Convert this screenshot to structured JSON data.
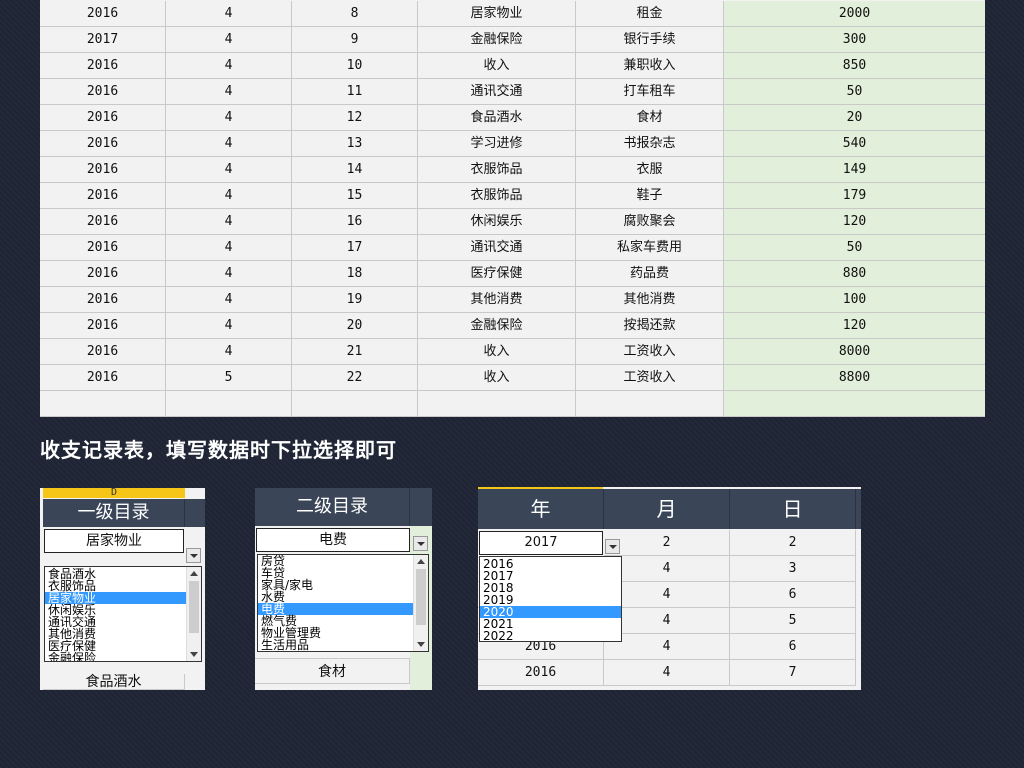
{
  "main_table": {
    "rows": [
      [
        "2016",
        "4",
        "8",
        "居家物业",
        "租金",
        "2000"
      ],
      [
        "2017",
        "4",
        "9",
        "金融保险",
        "银行手续",
        "300"
      ],
      [
        "2016",
        "4",
        "10",
        "收入",
        "兼职收入",
        "850"
      ],
      [
        "2016",
        "4",
        "11",
        "通讯交通",
        "打车租车",
        "50"
      ],
      [
        "2016",
        "4",
        "12",
        "食品酒水",
        "食材",
        "20"
      ],
      [
        "2016",
        "4",
        "13",
        "学习进修",
        "书报杂志",
        "540"
      ],
      [
        "2016",
        "4",
        "14",
        "衣服饰品",
        "衣服",
        "149"
      ],
      [
        "2016",
        "4",
        "15",
        "衣服饰品",
        "鞋子",
        "179"
      ],
      [
        "2016",
        "4",
        "16",
        "休闲娱乐",
        "腐败聚会",
        "120"
      ],
      [
        "2016",
        "4",
        "17",
        "通讯交通",
        "私家车费用",
        "50"
      ],
      [
        "2016",
        "4",
        "18",
        "医疗保健",
        "药品费",
        "880"
      ],
      [
        "2016",
        "4",
        "19",
        "其他消费",
        "其他消费",
        "100"
      ],
      [
        "2016",
        "4",
        "20",
        "金融保险",
        "按揭还款",
        "120"
      ],
      [
        "2016",
        "4",
        "21",
        "收入",
        "工资收入",
        "8000"
      ],
      [
        "2016",
        "5",
        "22",
        "收入",
        "工资收入",
        "8800"
      ],
      [
        "",
        "",
        "",
        "",
        "",
        ""
      ]
    ]
  },
  "caption": "收支记录表，填写数据时下拉选择即可",
  "panel1": {
    "col_letter": "D",
    "header": "一级目录",
    "selected": "居家物业",
    "options": [
      "食品酒水",
      "衣服饰品",
      "居家物业",
      "休闲娱乐",
      "通讯交通",
      "其他消费",
      "医疗保健",
      "金融保险"
    ],
    "selected_index": 2,
    "below": "食品酒水"
  },
  "panel2": {
    "header": "二级目录",
    "selected": "电费",
    "options": [
      "房贷",
      "车贷",
      "家具/家电",
      "水费",
      "电费",
      "燃气费",
      "物业管理费",
      "生活用品"
    ],
    "selected_index": 4,
    "below": "食材"
  },
  "panel3": {
    "headers": [
      "年",
      "月",
      "日"
    ],
    "selected_year": "2017",
    "year_options": [
      "2016",
      "2017",
      "2018",
      "2019",
      "2020",
      "2021",
      "2022"
    ],
    "selected_index": 4,
    "rows": [
      [
        "2017",
        "2",
        "2"
      ],
      [
        "",
        "4",
        "3"
      ],
      [
        "",
        "4",
        "6"
      ],
      [
        "",
        "4",
        "5"
      ],
      [
        "2016",
        "4",
        "6"
      ],
      [
        "2016",
        "4",
        "7"
      ]
    ]
  },
  "colors": {
    "header_bg": "#3a4558",
    "amount_bg": "#e2efda",
    "selection": "#3399ff",
    "col_letter_bg": "#f5c518"
  }
}
